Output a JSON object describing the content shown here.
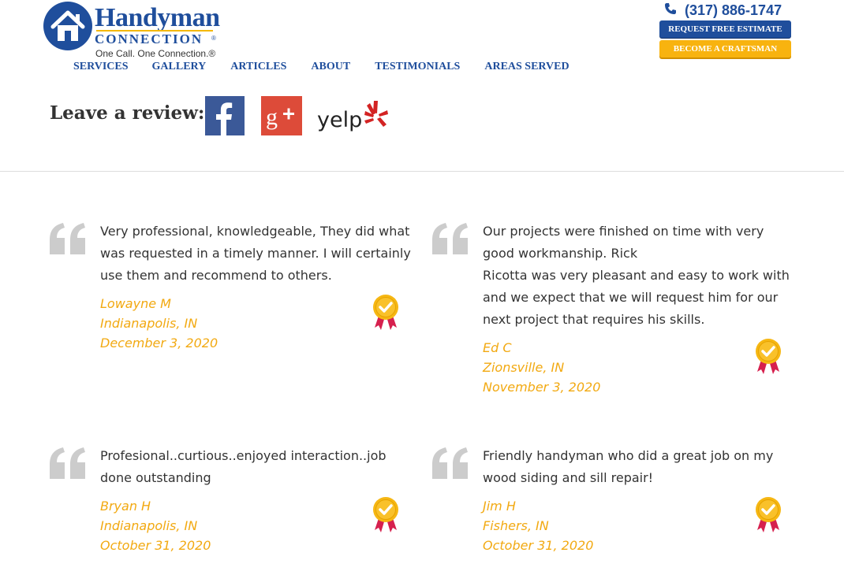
{
  "brand": {
    "name": "Handyman",
    "sub": "CONNECTION",
    "reg": "®",
    "tagline": "One Call. One Connection.®"
  },
  "nav": {
    "items": [
      {
        "label": "SERVICES"
      },
      {
        "label": "GALLERY"
      },
      {
        "label": "ARTICLES"
      },
      {
        "label": "ABOUT"
      },
      {
        "label": "TESTIMONIALS"
      },
      {
        "label": "AREAS SERVED"
      }
    ]
  },
  "header": {
    "phone": "(317) 886-1747",
    "estimate_button": "REQUEST FREE ESTIMATE",
    "craftsman_button": "BECOME A CRAFTSMAN"
  },
  "review": {
    "label": "Leave a review:",
    "networks": [
      {
        "name": "facebook-icon",
        "glyph": "f"
      },
      {
        "name": "google-plus-icon",
        "glyph": "g+"
      },
      {
        "name": "yelp-logo",
        "glyph": "yelp"
      }
    ]
  },
  "testimonials": [
    {
      "lines": [
        "Very professional, knowledgeable, They did what",
        "was requested in a timely manner. I will certainly",
        "use them and recommend to others."
      ],
      "name": "Lowayne M",
      "location": "Indianapolis, IN",
      "date": "December 3, 2020"
    },
    {
      "lines": [
        "Our projects were finished on time with very",
        "good workmanship. Rick",
        "Ricotta was very pleasant and easy to work with",
        "and we expect that we will request him for our",
        "next project that requires his skills."
      ],
      "name": "Ed C",
      "location": "Zionsville, IN",
      "date": "November 3, 2020"
    },
    {
      "lines": [
        "Profesional..curtious..enjoyed interaction..job",
        "done outstanding"
      ],
      "name": "Bryan H",
      "location": "Indianapolis, IN",
      "date": "October 31, 2020"
    },
    {
      "lines": [
        "Friendly handyman who did a great job on my",
        "wood siding and sill repair!"
      ],
      "name": "Jim H",
      "location": "Fishers, IN",
      "date": "October 31, 2020"
    }
  ],
  "colors": {
    "brand_blue": "#1f4e9c",
    "accent_yellow": "#f8b30f",
    "meta_orange": "#f2a911",
    "quote_gray": "#cccccc"
  }
}
